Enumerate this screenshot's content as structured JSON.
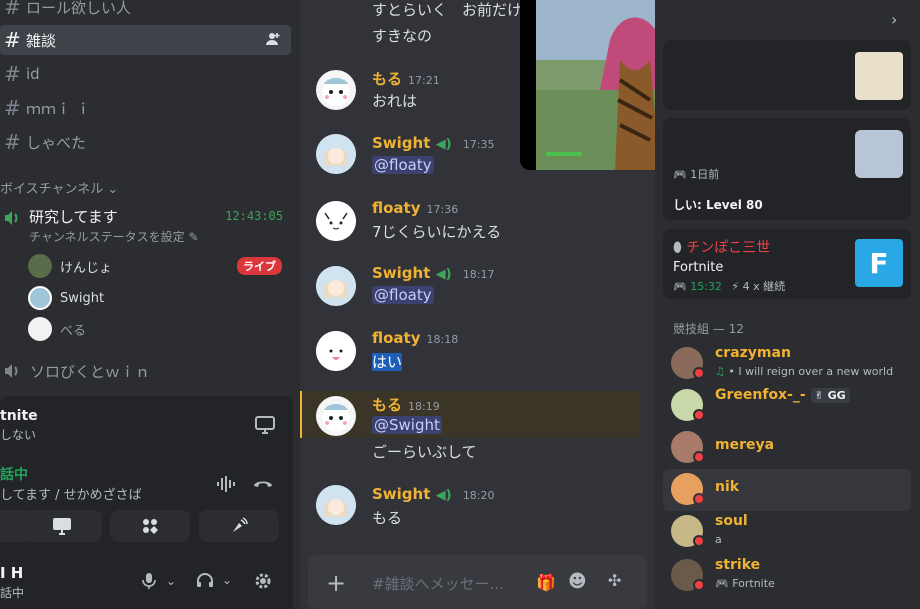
{
  "sidebar": {
    "channels": [
      {
        "label": "ロール欲しい人",
        "active": false
      },
      {
        "label": "雑談",
        "active": true
      },
      {
        "label": "id",
        "active": false
      },
      {
        "label": "ｍｍｉ ｉ",
        "active": false
      },
      {
        "label": "しゃべた",
        "active": false
      }
    ],
    "voice_category": "ボイスチャンネル",
    "voice_channel": {
      "name": "研究してます",
      "timer": "12:43:05",
      "status_placeholder": "チャンネルステータスを設定"
    },
    "voice_users": [
      {
        "name": "けんじょ",
        "badge": "ライブ"
      },
      {
        "name": "Swight",
        "badge": ""
      },
      {
        "name": "べる",
        "badge": ""
      }
    ],
    "voice_channel_2": "ソロびくとｗｉｎ"
  },
  "activity": {
    "game_title": "tnite",
    "game_sub": "しない",
    "voice_connected": "話中",
    "voice_sub": "してます / せかめざさば"
  },
  "user_panel": {
    "name": "I H",
    "status": "話中"
  },
  "messages": [
    {
      "user": "",
      "time": "",
      "text": "すとらいく　お前だけ",
      "extra": "すきなの"
    },
    {
      "user": "もる",
      "time": "17:21",
      "text": "おれは"
    },
    {
      "user": "Swight",
      "time": "17:35",
      "text": "@floaty"
    },
    {
      "user": "floaty",
      "time": "17:36",
      "text": "7じくらいにかえる"
    },
    {
      "user": "Swight",
      "time": "18:17",
      "text": "@floaty"
    },
    {
      "user": "floaty",
      "time": "18:18",
      "text": "はい"
    },
    {
      "user": "もる",
      "time": "18:19",
      "text": "@Swight",
      "extra": "ごーらいぶして"
    },
    {
      "user": "Swight",
      "time": "18:20",
      "text": "もる"
    }
  ],
  "composer": {
    "placeholder": "#雑談へメッセー..."
  },
  "right": {
    "card1_time": "1日前",
    "card1_level": "しい: Level 80",
    "card2": {
      "name": "チンぽこ三世",
      "game": "Fortnite",
      "time": "15:32",
      "streak": "4 x 継続"
    },
    "section": "競技組 — 12",
    "members": [
      {
        "name": "crazyman",
        "status": "I will reign over a new world",
        "badge": ""
      },
      {
        "name": "Greenfox-_-",
        "status": "",
        "badge": "GG"
      },
      {
        "name": "mereya",
        "status": "",
        "badge": ""
      },
      {
        "name": "nik",
        "status": "",
        "badge": ""
      },
      {
        "name": "soul",
        "status": "a",
        "badge": ""
      },
      {
        "name": "strike",
        "status": "Fortnite",
        "badge": ""
      }
    ]
  },
  "colors": {
    "accent_yellow": "#f0b232",
    "green": "#23a55a",
    "red": "#f23f43",
    "mention_bg": "#3c4270"
  }
}
